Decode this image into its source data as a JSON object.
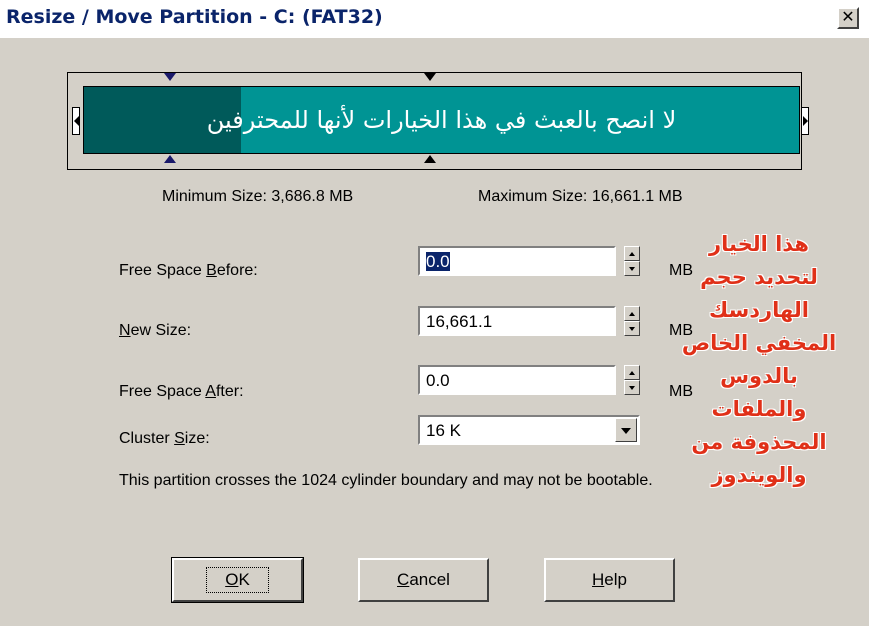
{
  "window": {
    "title": "Resize / Move Partition - C:  (FAT32)",
    "close_glyph": "✕"
  },
  "gauge": {
    "banner_text": "لا انصح بالعبث في هذا الخيارات لأنها للمحترفين",
    "used_fraction": 0.22,
    "used_color": "#005a5a",
    "free_color": "#009494"
  },
  "size_info": {
    "min_label": "Minimum Size:",
    "min_value": "3,686.8 MB",
    "max_label": "Maximum Size:",
    "max_value": "16,661.1 MB"
  },
  "fields": {
    "free_before": {
      "label_pre": "Free Space ",
      "label_key": "B",
      "label_post": "efore:",
      "value": "0.0",
      "unit": "MB"
    },
    "new_size": {
      "label_pre": "",
      "label_key": "N",
      "label_post": "ew Size:",
      "value": "16,661.1",
      "unit": "MB"
    },
    "free_after": {
      "label_pre": "Free Space ",
      "label_key": "A",
      "label_post": "fter:",
      "value": "0.0",
      "unit": "MB"
    },
    "cluster_size": {
      "label_pre": "Cluster ",
      "label_key": "S",
      "label_post": "ize:",
      "value": "16 K"
    }
  },
  "note": "This partition crosses the 1024 cylinder boundary and may not be bootable.",
  "buttons": {
    "ok": {
      "key": "O",
      "rest": "K"
    },
    "cancel": {
      "key": "C",
      "rest": "ancel"
    },
    "help": {
      "key": "H",
      "rest": "elp"
    }
  },
  "annotation": {
    "lines": [
      "هذا الخيار",
      "لتحديد حجم",
      "الهاردسك",
      "المخفي الخاص",
      "بالدوس",
      "والملفات",
      "المحذوفة من",
      "والويندوز"
    ],
    "color": "#e03018"
  }
}
